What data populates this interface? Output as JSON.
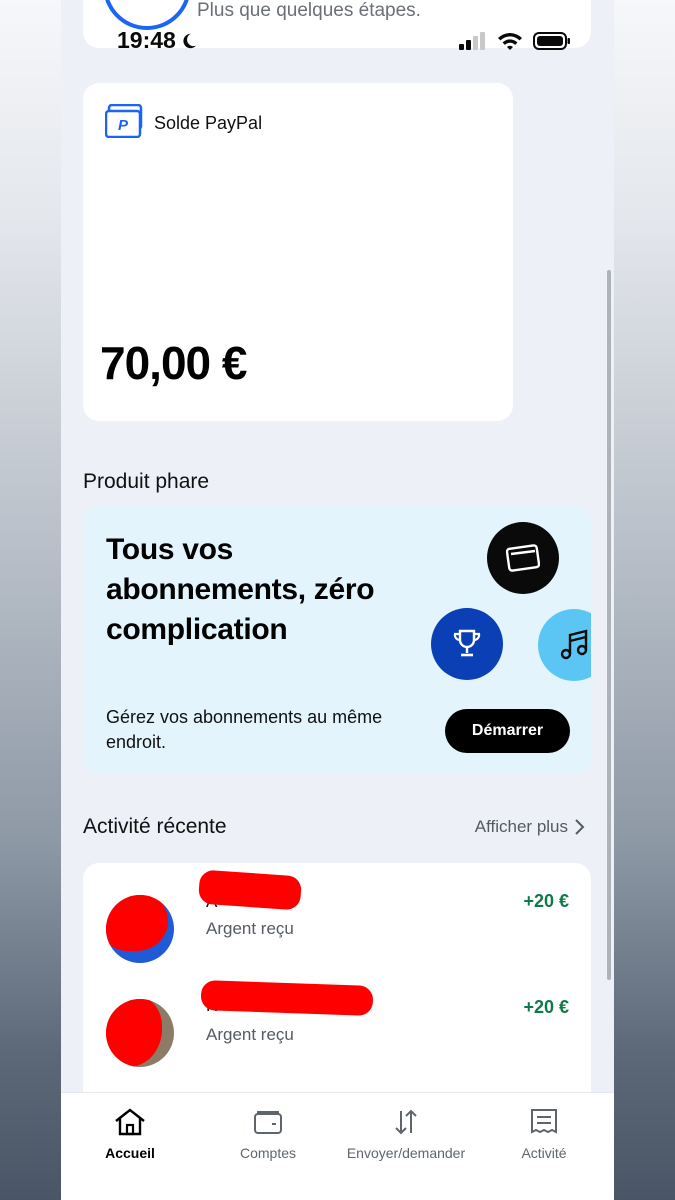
{
  "top_card": {
    "text": "Plus que quelques étapes."
  },
  "status_bar": {
    "time": "19:48"
  },
  "balance": {
    "label": "Solde PayPal",
    "amount": "70,00 €"
  },
  "featured": {
    "section_title": "Produit phare",
    "headline": "Tous vos abonnements, zéro complication",
    "body": "Gérez vos abonnements au même endroit.",
    "button_label": "Démarrer"
  },
  "activity": {
    "section_title": "Activité récente",
    "see_more_label": "Afficher plus",
    "items": [
      {
        "name_visible": "A",
        "subtitle": "Argent reçu",
        "amount": "+20 €"
      },
      {
        "name_visible": "K",
        "subtitle": "Argent reçu",
        "amount": "+20 €"
      }
    ]
  },
  "nav": {
    "items": [
      {
        "label": "Accueil",
        "icon": "home-icon",
        "active": true
      },
      {
        "label": "Comptes",
        "icon": "wallet-icon",
        "active": false
      },
      {
        "label": "Envoyer/demander",
        "icon": "transfer-arrows-icon",
        "active": false
      },
      {
        "label": "Activité",
        "icon": "receipt-icon",
        "active": false
      }
    ]
  },
  "colors": {
    "accent_blue": "#1c64f2",
    "positive_green": "#0e7a4a",
    "featured_bg": "#e3f4fc"
  }
}
